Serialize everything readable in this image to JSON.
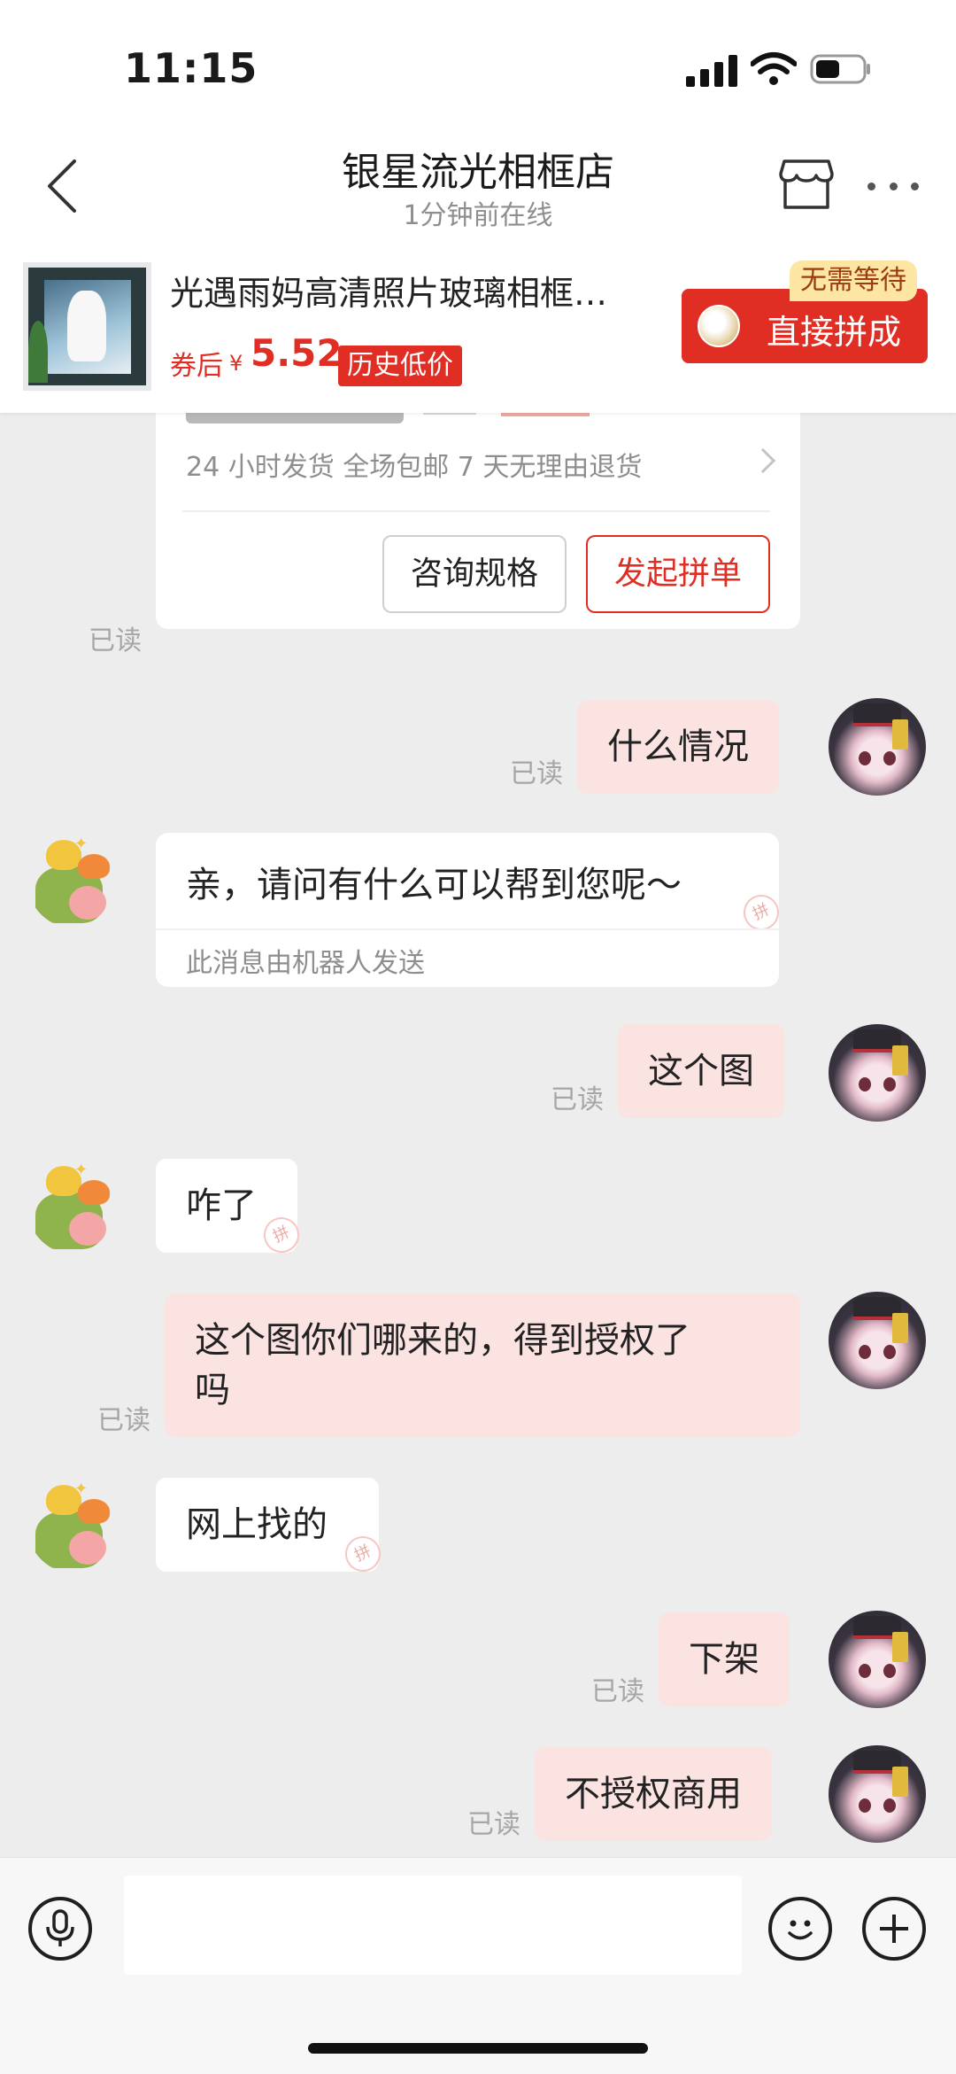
{
  "status_bar": {
    "time": "11:15"
  },
  "header": {
    "title": "银星流光相框店",
    "subtitle": "1分钟前在线"
  },
  "product": {
    "name": "光遇雨妈高清照片玻璃相框…",
    "coupon_label": "券后",
    "currency": "¥",
    "price": "5.52",
    "low_badge": "历史低价",
    "join_button": "直接拼成",
    "nowait_badge": "无需等待"
  },
  "card": {
    "guarantee": "24 小时发货  全场包邮  7 天无理由退货",
    "spec_button": "咨询规格",
    "group_button": "发起拼单",
    "read": "已读"
  },
  "messages": [
    {
      "from": "me",
      "text": "什么情况",
      "status": "已读"
    },
    {
      "from": "bot",
      "text": "亲，请问有什么可以帮到您呢～",
      "note": "此消息由机器人发送"
    },
    {
      "from": "me",
      "text": "这个图",
      "status": "已读"
    },
    {
      "from": "them",
      "text": "咋了"
    },
    {
      "from": "me",
      "line1": "这个图你们哪来的，得到授权了",
      "line2": "吗",
      "status": "已读"
    },
    {
      "from": "them",
      "text": "网上找的"
    },
    {
      "from": "me",
      "text": "下架",
      "status": "已读"
    },
    {
      "from": "me",
      "text": "不授权商用",
      "status": "已读"
    }
  ],
  "pin_glyph": "拼",
  "icons": [
    "back-icon",
    "store-icon",
    "more-icon",
    "mic-icon",
    "emoji-icon",
    "plus-icon",
    "chevron-right-icon"
  ],
  "colors": {
    "accent": "#e02e24",
    "my_bubble": "#fbe3e2",
    "background": "#ededed"
  }
}
